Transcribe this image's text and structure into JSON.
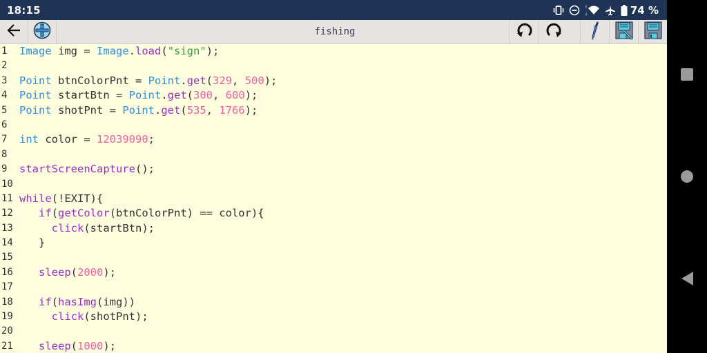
{
  "status_bar": {
    "time": "18:15",
    "icons": [
      "vibrate-icon",
      "do-not-disturb-icon",
      "wifi-icon",
      "airplane-icon",
      "battery-icon"
    ],
    "battery_percent": "74 %"
  },
  "toolbar": {
    "title": "fishing",
    "buttons_left": [
      "back-arrow-icon",
      "add-icon"
    ],
    "buttons_right": [
      "undo-icon",
      "redo-icon",
      "pipette-icon",
      "save-as-icon",
      "save-icon"
    ]
  },
  "editor": {
    "lines": [
      {
        "num": "1",
        "tokens": [
          {
            "t": "Image",
            "c": "type"
          },
          {
            "t": " img = ",
            "c": "plain"
          },
          {
            "t": "Image",
            "c": "type"
          },
          {
            "t": ".",
            "c": "plain"
          },
          {
            "t": "load",
            "c": "fn"
          },
          {
            "t": "(",
            "c": "plain"
          },
          {
            "t": "\"sign\"",
            "c": "str"
          },
          {
            "t": ");",
            "c": "plain"
          }
        ]
      },
      {
        "num": "2",
        "tokens": []
      },
      {
        "num": "3",
        "tokens": [
          {
            "t": "Point",
            "c": "type"
          },
          {
            "t": " btnColorPnt = ",
            "c": "plain"
          },
          {
            "t": "Point",
            "c": "type"
          },
          {
            "t": ".",
            "c": "plain"
          },
          {
            "t": "get",
            "c": "fn"
          },
          {
            "t": "(",
            "c": "plain"
          },
          {
            "t": "329",
            "c": "num"
          },
          {
            "t": ", ",
            "c": "plain"
          },
          {
            "t": "500",
            "c": "num"
          },
          {
            "t": ");",
            "c": "plain"
          }
        ]
      },
      {
        "num": "4",
        "tokens": [
          {
            "t": "Point",
            "c": "type"
          },
          {
            "t": " startBtn = ",
            "c": "plain"
          },
          {
            "t": "Point",
            "c": "type"
          },
          {
            "t": ".",
            "c": "plain"
          },
          {
            "t": "get",
            "c": "fn"
          },
          {
            "t": "(",
            "c": "plain"
          },
          {
            "t": "300",
            "c": "num"
          },
          {
            "t": ", ",
            "c": "plain"
          },
          {
            "t": "600",
            "c": "num"
          },
          {
            "t": ");",
            "c": "plain"
          }
        ]
      },
      {
        "num": "5",
        "tokens": [
          {
            "t": "Point",
            "c": "type"
          },
          {
            "t": " shotPnt = ",
            "c": "plain"
          },
          {
            "t": "Point",
            "c": "type"
          },
          {
            "t": ".",
            "c": "plain"
          },
          {
            "t": "get",
            "c": "fn"
          },
          {
            "t": "(",
            "c": "plain"
          },
          {
            "t": "535",
            "c": "num"
          },
          {
            "t": ", ",
            "c": "plain"
          },
          {
            "t": "1766",
            "c": "num"
          },
          {
            "t": ");",
            "c": "plain"
          }
        ]
      },
      {
        "num": "6",
        "tokens": []
      },
      {
        "num": "7",
        "tokens": [
          {
            "t": "int",
            "c": "type"
          },
          {
            "t": " color = ",
            "c": "plain"
          },
          {
            "t": "12039090",
            "c": "num"
          },
          {
            "t": ";",
            "c": "plain"
          }
        ]
      },
      {
        "num": "8",
        "tokens": []
      },
      {
        "num": "9",
        "tokens": [
          {
            "t": "startScreenCapture",
            "c": "fn"
          },
          {
            "t": "();",
            "c": "plain"
          }
        ]
      },
      {
        "num": "10",
        "tokens": []
      },
      {
        "num": "11",
        "tokens": [
          {
            "t": "while",
            "c": "fn"
          },
          {
            "t": "(!EXIT){",
            "c": "plain"
          }
        ]
      },
      {
        "num": "12",
        "tokens": [
          {
            "t": "   ",
            "c": "plain"
          },
          {
            "t": "if",
            "c": "fn"
          },
          {
            "t": "(",
            "c": "plain"
          },
          {
            "t": "getColor",
            "c": "fn"
          },
          {
            "t": "(btnColorPnt) == color){",
            "c": "plain"
          }
        ]
      },
      {
        "num": "13",
        "tokens": [
          {
            "t": "     ",
            "c": "plain"
          },
          {
            "t": "click",
            "c": "fn"
          },
          {
            "t": "(startBtn);",
            "c": "plain"
          }
        ]
      },
      {
        "num": "14",
        "tokens": [
          {
            "t": "   }",
            "c": "plain"
          }
        ]
      },
      {
        "num": "15",
        "tokens": []
      },
      {
        "num": "16",
        "tokens": [
          {
            "t": "   ",
            "c": "plain"
          },
          {
            "t": "sleep",
            "c": "fn"
          },
          {
            "t": "(",
            "c": "plain"
          },
          {
            "t": "2000",
            "c": "num"
          },
          {
            "t": ");",
            "c": "plain"
          }
        ]
      },
      {
        "num": "17",
        "tokens": []
      },
      {
        "num": "18",
        "tokens": [
          {
            "t": "   ",
            "c": "plain"
          },
          {
            "t": "if",
            "c": "fn"
          },
          {
            "t": "(",
            "c": "plain"
          },
          {
            "t": "hasImg",
            "c": "fn"
          },
          {
            "t": "(img))",
            "c": "plain"
          }
        ]
      },
      {
        "num": "19",
        "tokens": [
          {
            "t": "     ",
            "c": "plain"
          },
          {
            "t": "click",
            "c": "fn"
          },
          {
            "t": "(shotPnt);",
            "c": "plain"
          }
        ]
      },
      {
        "num": "20",
        "tokens": []
      },
      {
        "num": "21",
        "tokens": [
          {
            "t": "   ",
            "c": "plain"
          },
          {
            "t": "sleep",
            "c": "fn"
          },
          {
            "t": "(",
            "c": "plain"
          },
          {
            "t": "1000",
            "c": "num"
          },
          {
            "t": ");",
            "c": "plain"
          }
        ]
      }
    ]
  },
  "nav_bar": {
    "buttons": [
      "recents-icon",
      "home-icon",
      "back-icon"
    ]
  },
  "colors": {
    "status_bar_bg": "#1f3354",
    "editor_bg": "#fefedf",
    "type": "#2f8fe0",
    "function": "#9a2fc8",
    "number": "#ee5fa0",
    "string": "#3a9a3a"
  }
}
